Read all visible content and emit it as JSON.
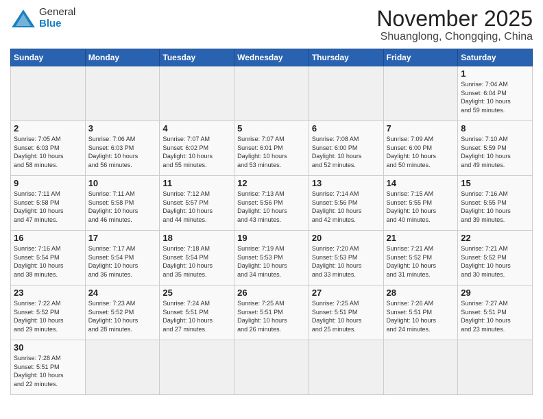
{
  "header": {
    "logo_general": "General",
    "logo_blue": "Blue",
    "month_title": "November 2025",
    "location": "Shuanglong, Chongqing, China"
  },
  "days_of_week": [
    "Sunday",
    "Monday",
    "Tuesday",
    "Wednesday",
    "Thursday",
    "Friday",
    "Saturday"
  ],
  "weeks": [
    [
      {
        "day": "",
        "info": ""
      },
      {
        "day": "",
        "info": ""
      },
      {
        "day": "",
        "info": ""
      },
      {
        "day": "",
        "info": ""
      },
      {
        "day": "",
        "info": ""
      },
      {
        "day": "",
        "info": ""
      },
      {
        "day": "1",
        "info": "Sunrise: 7:04 AM\nSunset: 6:04 PM\nDaylight: 10 hours\nand 59 minutes."
      }
    ],
    [
      {
        "day": "2",
        "info": "Sunrise: 7:05 AM\nSunset: 6:03 PM\nDaylight: 10 hours\nand 58 minutes."
      },
      {
        "day": "3",
        "info": "Sunrise: 7:06 AM\nSunset: 6:03 PM\nDaylight: 10 hours\nand 56 minutes."
      },
      {
        "day": "4",
        "info": "Sunrise: 7:07 AM\nSunset: 6:02 PM\nDaylight: 10 hours\nand 55 minutes."
      },
      {
        "day": "5",
        "info": "Sunrise: 7:07 AM\nSunset: 6:01 PM\nDaylight: 10 hours\nand 53 minutes."
      },
      {
        "day": "6",
        "info": "Sunrise: 7:08 AM\nSunset: 6:00 PM\nDaylight: 10 hours\nand 52 minutes."
      },
      {
        "day": "7",
        "info": "Sunrise: 7:09 AM\nSunset: 6:00 PM\nDaylight: 10 hours\nand 50 minutes."
      },
      {
        "day": "8",
        "info": "Sunrise: 7:10 AM\nSunset: 5:59 PM\nDaylight: 10 hours\nand 49 minutes."
      }
    ],
    [
      {
        "day": "9",
        "info": "Sunrise: 7:11 AM\nSunset: 5:58 PM\nDaylight: 10 hours\nand 47 minutes."
      },
      {
        "day": "10",
        "info": "Sunrise: 7:11 AM\nSunset: 5:58 PM\nDaylight: 10 hours\nand 46 minutes."
      },
      {
        "day": "11",
        "info": "Sunrise: 7:12 AM\nSunset: 5:57 PM\nDaylight: 10 hours\nand 44 minutes."
      },
      {
        "day": "12",
        "info": "Sunrise: 7:13 AM\nSunset: 5:56 PM\nDaylight: 10 hours\nand 43 minutes."
      },
      {
        "day": "13",
        "info": "Sunrise: 7:14 AM\nSunset: 5:56 PM\nDaylight: 10 hours\nand 42 minutes."
      },
      {
        "day": "14",
        "info": "Sunrise: 7:15 AM\nSunset: 5:55 PM\nDaylight: 10 hours\nand 40 minutes."
      },
      {
        "day": "15",
        "info": "Sunrise: 7:16 AM\nSunset: 5:55 PM\nDaylight: 10 hours\nand 39 minutes."
      }
    ],
    [
      {
        "day": "16",
        "info": "Sunrise: 7:16 AM\nSunset: 5:54 PM\nDaylight: 10 hours\nand 38 minutes."
      },
      {
        "day": "17",
        "info": "Sunrise: 7:17 AM\nSunset: 5:54 PM\nDaylight: 10 hours\nand 36 minutes."
      },
      {
        "day": "18",
        "info": "Sunrise: 7:18 AM\nSunset: 5:54 PM\nDaylight: 10 hours\nand 35 minutes."
      },
      {
        "day": "19",
        "info": "Sunrise: 7:19 AM\nSunset: 5:53 PM\nDaylight: 10 hours\nand 34 minutes."
      },
      {
        "day": "20",
        "info": "Sunrise: 7:20 AM\nSunset: 5:53 PM\nDaylight: 10 hours\nand 33 minutes."
      },
      {
        "day": "21",
        "info": "Sunrise: 7:21 AM\nSunset: 5:52 PM\nDaylight: 10 hours\nand 31 minutes."
      },
      {
        "day": "22",
        "info": "Sunrise: 7:21 AM\nSunset: 5:52 PM\nDaylight: 10 hours\nand 30 minutes."
      }
    ],
    [
      {
        "day": "23",
        "info": "Sunrise: 7:22 AM\nSunset: 5:52 PM\nDaylight: 10 hours\nand 29 minutes."
      },
      {
        "day": "24",
        "info": "Sunrise: 7:23 AM\nSunset: 5:52 PM\nDaylight: 10 hours\nand 28 minutes."
      },
      {
        "day": "25",
        "info": "Sunrise: 7:24 AM\nSunset: 5:51 PM\nDaylight: 10 hours\nand 27 minutes."
      },
      {
        "day": "26",
        "info": "Sunrise: 7:25 AM\nSunset: 5:51 PM\nDaylight: 10 hours\nand 26 minutes."
      },
      {
        "day": "27",
        "info": "Sunrise: 7:25 AM\nSunset: 5:51 PM\nDaylight: 10 hours\nand 25 minutes."
      },
      {
        "day": "28",
        "info": "Sunrise: 7:26 AM\nSunset: 5:51 PM\nDaylight: 10 hours\nand 24 minutes."
      },
      {
        "day": "29",
        "info": "Sunrise: 7:27 AM\nSunset: 5:51 PM\nDaylight: 10 hours\nand 23 minutes."
      }
    ],
    [
      {
        "day": "30",
        "info": "Sunrise: 7:28 AM\nSunset: 5:51 PM\nDaylight: 10 hours\nand 22 minutes."
      },
      {
        "day": "",
        "info": ""
      },
      {
        "day": "",
        "info": ""
      },
      {
        "day": "",
        "info": ""
      },
      {
        "day": "",
        "info": ""
      },
      {
        "day": "",
        "info": ""
      },
      {
        "day": "",
        "info": ""
      }
    ]
  ]
}
